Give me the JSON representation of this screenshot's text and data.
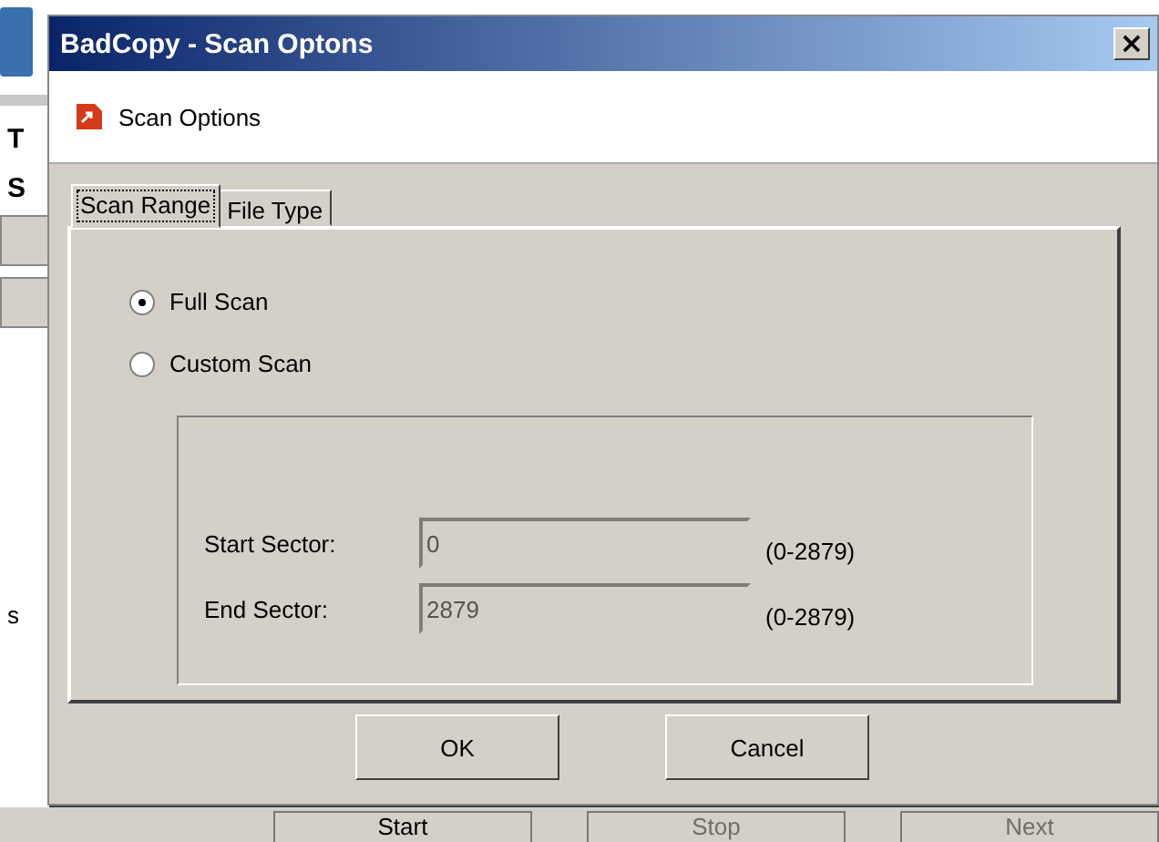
{
  "background_window": {
    "side_labels": [
      "T",
      "S",
      "s"
    ],
    "buttons": [
      {
        "label": "Start",
        "disabled": false
      },
      {
        "label": "Stop",
        "disabled": true
      },
      {
        "label": "Next",
        "disabled": true
      }
    ]
  },
  "dialog": {
    "title": "BadCopy - Scan Optons",
    "close": "×",
    "header": "Scan Options",
    "tabs": [
      {
        "label": "Scan Range",
        "selected": true
      },
      {
        "label": "File Type",
        "selected": false
      }
    ],
    "radios": [
      {
        "label": "Full Scan",
        "selected": true
      },
      {
        "label": "Custom Scan",
        "selected": false
      }
    ],
    "fields": [
      {
        "label": "Start Sector:",
        "value": "0",
        "disabled": true,
        "range": "(0-2879)"
      },
      {
        "label": "End Sector:",
        "value": "2879",
        "disabled": true,
        "range": "(0-2879)"
      }
    ],
    "buttons": [
      "OK",
      "Cancel"
    ]
  }
}
